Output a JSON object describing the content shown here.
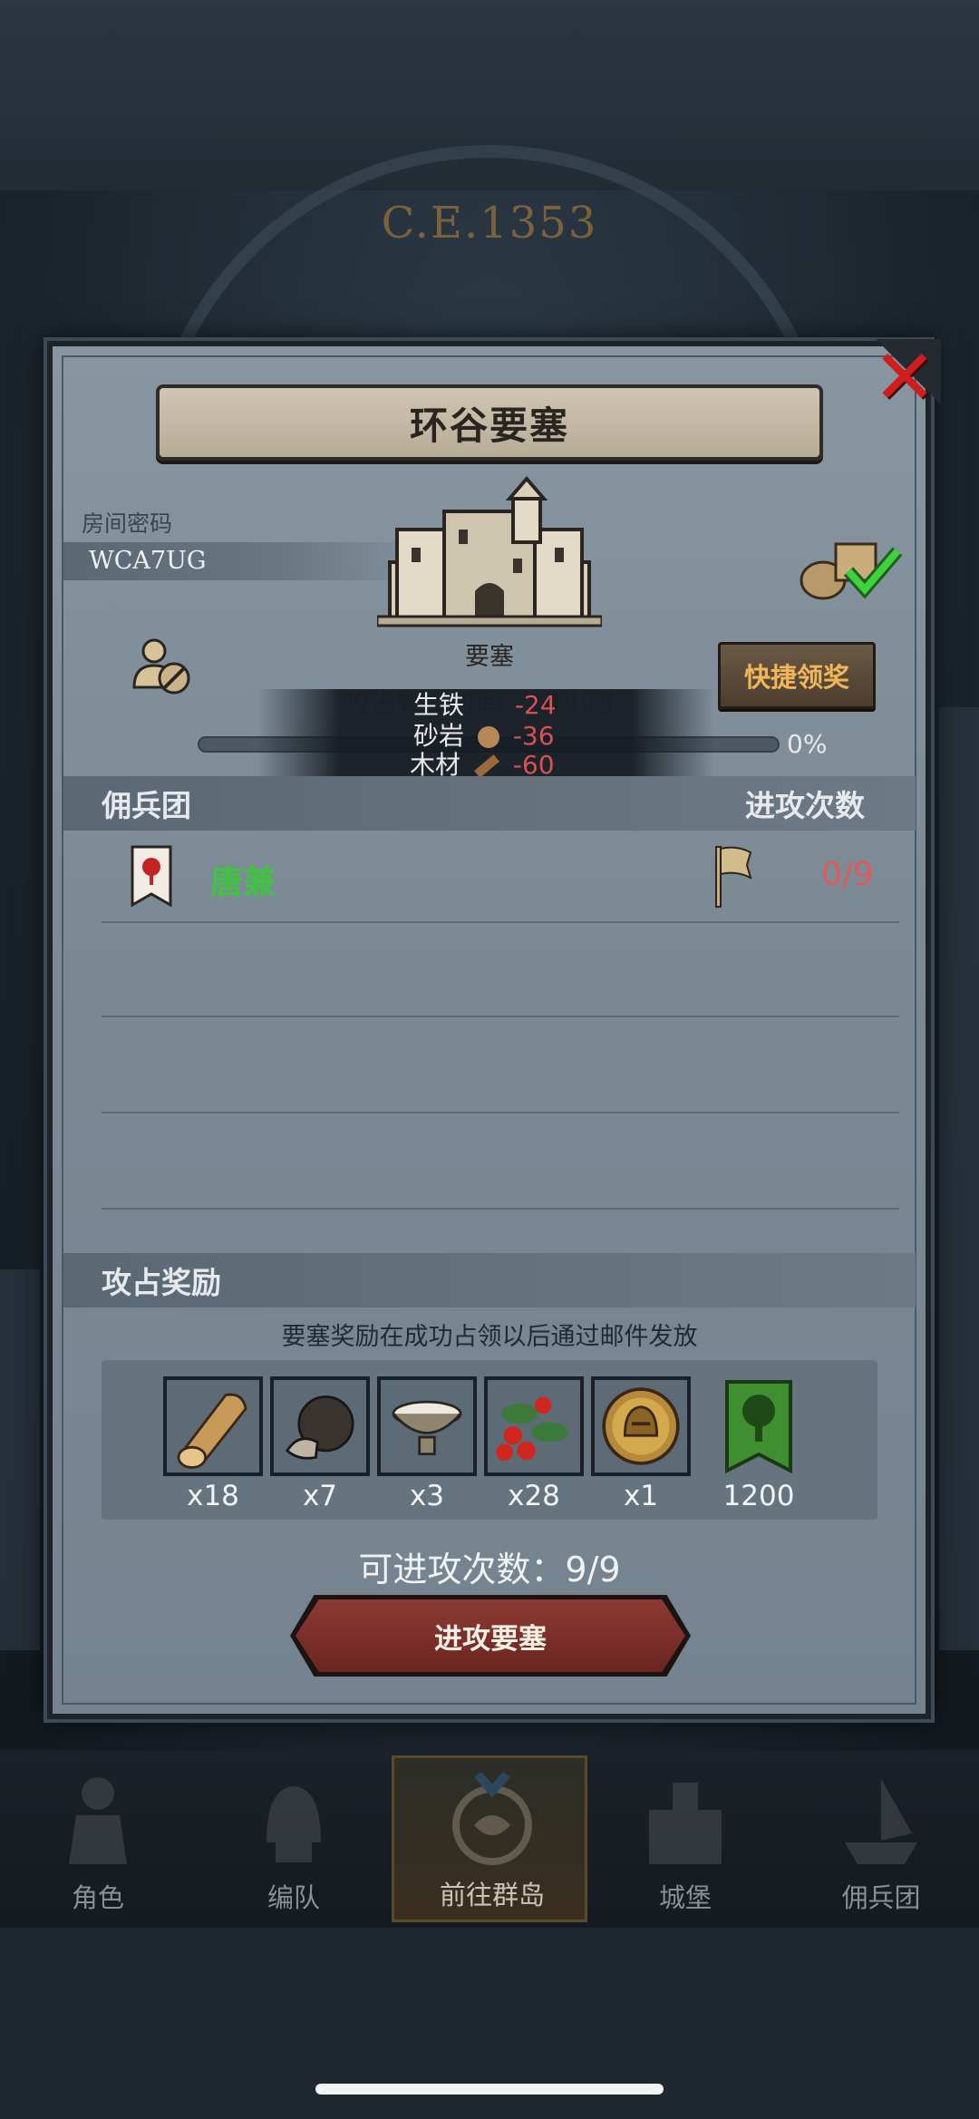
{
  "background": {
    "year_label": "C.E.1353"
  },
  "dialog": {
    "title": "环谷要塞",
    "close_icon": "close-x-icon",
    "room_code_label": "房间密码",
    "room_code": "WCA7UG",
    "fortress_label": "要塞",
    "quick_claim_label": "快捷领奖",
    "tooltip": {
      "underlying_text": "攻占剩余时间：14小时",
      "rows": [
        {
          "name": "生铁",
          "value": "-24"
        },
        {
          "name": "砂岩",
          "value": "-36"
        },
        {
          "name": "木材",
          "value": "-60"
        }
      ]
    },
    "progress": {
      "percent_label": "0%",
      "value": 0
    },
    "mercenary_section": {
      "title": "佣兵团",
      "attack_count_header": "进攻次数",
      "members": [
        {
          "name": "唐兼",
          "attack_count": "0/9"
        }
      ]
    },
    "reward_section": {
      "title": "攻占奖励",
      "note": "要塞奖励在成功占领以后通过邮件发放",
      "items": [
        {
          "icon": "wood-log-icon",
          "qty": "x18"
        },
        {
          "icon": "truffle-icon",
          "qty": "x7"
        },
        {
          "icon": "bowl-icon",
          "qty": "x3"
        },
        {
          "icon": "berries-icon",
          "qty": "x28"
        },
        {
          "icon": "helmet-coin-icon",
          "qty": "x1"
        },
        {
          "icon": "tree-banner-icon",
          "qty": "1200"
        }
      ]
    },
    "attempts_label": "可进攻次数：9/9",
    "attack_button_label": "进攻要塞"
  },
  "bottom_nav": {
    "items": [
      {
        "label": "角色",
        "icon": "knight-icon"
      },
      {
        "label": "编队",
        "icon": "helmet-icon"
      },
      {
        "label": "前往群岛",
        "icon": "compass-map-icon",
        "active": true
      },
      {
        "label": "城堡",
        "icon": "castle-icon"
      },
      {
        "label": "佣兵团",
        "icon": "ship-icon"
      }
    ]
  },
  "colors": {
    "accent_red": "#d11d1d",
    "merc_green": "#3fc43f",
    "count_red": "#e05a5a",
    "quick_claim_text": "#f2b65a"
  }
}
